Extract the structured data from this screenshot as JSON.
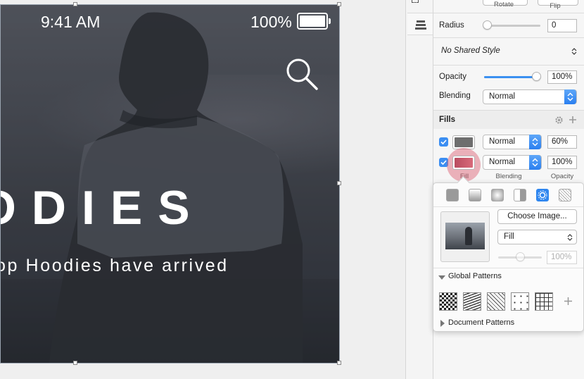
{
  "canvas": {
    "status_bar": {
      "time": "9:41 AM",
      "battery": "100%"
    },
    "headline": "ODIES",
    "subline": "op Hoodies have arrived"
  },
  "inspector": {
    "top_labels": {
      "rotate": "Rotate",
      "flip": "Flip"
    },
    "radius": {
      "label": "Radius",
      "value": "0"
    },
    "shared_style": "No Shared Style",
    "opacity": {
      "label": "Opacity",
      "value": "100%",
      "level": 1.0
    },
    "blending": {
      "label": "Blending",
      "value": "Normal"
    },
    "fills": {
      "title": "Fills",
      "rows": [
        {
          "blend": "Normal",
          "opacity": "60%",
          "checked": true,
          "swatch_color": "#6e6e6e"
        },
        {
          "blend": "Normal",
          "opacity": "100%",
          "checked": true,
          "swatch_color": "#c24f63"
        }
      ],
      "col_labels": {
        "fill": "Fill",
        "blending": "Blending",
        "opacity": "Opacity"
      }
    },
    "popover": {
      "choose_image": "Choose Image...",
      "mode": "Fill",
      "opacity": "100%",
      "global_patterns": "Global Patterns",
      "document_patterns": "Document Patterns"
    }
  },
  "colors": {
    "accent": "#3b8ef2",
    "highlight": "#dc5a6e"
  }
}
